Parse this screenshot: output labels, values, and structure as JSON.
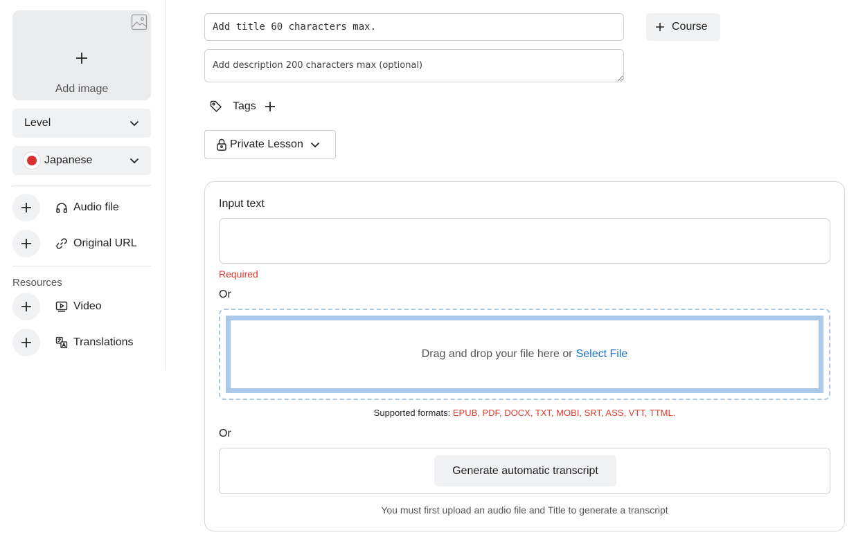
{
  "sidebar": {
    "add_image_label": "Add image",
    "level_label": "Level",
    "language_label": "Japanese",
    "flag_color": "#d93134",
    "items": [
      {
        "label": "Audio file",
        "icon": "headphones-icon"
      },
      {
        "label": "Original URL",
        "icon": "link-icon"
      }
    ],
    "resources_label": "Resources",
    "resources": [
      {
        "label": "Video",
        "icon": "video-icon"
      },
      {
        "label": "Translations",
        "icon": "translate-icon"
      }
    ]
  },
  "form": {
    "title_placeholder": "Add title 60 characters max.",
    "description_placeholder": "Add description 200 characters max (optional)",
    "course_label": "Course",
    "tags_label": "Tags",
    "privacy_label": "Private Lesson"
  },
  "panel": {
    "input_text_label": "Input text",
    "required_label": "Required",
    "or_label_1": "Or",
    "drop_text": "Drag and drop your file here or",
    "select_file_label": "Select File",
    "formats_prefix": "Supported formats:",
    "formats_list": "EPUB, PDF, DOCX, TXT, MOBI, SRT, ASS, VTT, TTML.",
    "or_label_2": "Or",
    "generate_label": "Generate automatic transcript",
    "note": "You must first upload an audio file and Title to generate a transcript"
  },
  "colors": {
    "accent_link": "#1a73c8",
    "error": "#e03a2f",
    "dropzone_border": "#aac8ea"
  }
}
